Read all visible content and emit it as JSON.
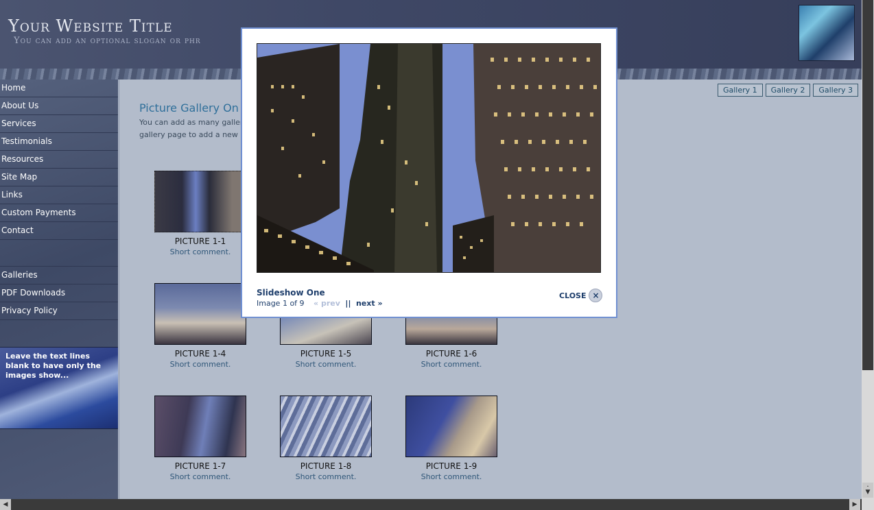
{
  "header": {
    "title": "Your Website Title",
    "slogan": "You can add an optional slogan or phr"
  },
  "sidebar": {
    "items": [
      "Home",
      "About Us",
      "Services",
      "Testimonials",
      "Resources",
      "Site Map",
      "Links",
      "Custom Payments",
      "Contact"
    ],
    "items2": [
      "Galleries",
      "PDF Downloads",
      "Privacy Policy"
    ],
    "promo": "Leave the text lines blank to have only the images show..."
  },
  "content": {
    "tabs": [
      "Gallery 1",
      "Gallery 2",
      "Gallery 3"
    ],
    "title": "Picture Gallery On",
    "intro": "You can add as many galler gallery page to add a new p",
    "thumbs": [
      {
        "label": "PICTURE 1-1",
        "comment": "Short comment."
      },
      {
        "label": "PICTURE 1-4",
        "comment": "Short comment."
      },
      {
        "label": "PICTURE 1-5",
        "comment": "Short comment."
      },
      {
        "label": "PICTURE 1-6",
        "comment": "Short comment."
      },
      {
        "label": "PICTURE 1-7",
        "comment": "Short comment."
      },
      {
        "label": "PICTURE 1-8",
        "comment": "Short comment."
      },
      {
        "label": "PICTURE 1-9",
        "comment": "Short comment."
      }
    ]
  },
  "lightbox": {
    "caption": "Slideshow One",
    "counter": "Image 1 of 9",
    "prev": "« prev",
    "separator": "||",
    "next": "next »",
    "close": "CLOSE",
    "close_icon": "×"
  },
  "scrollbar": {
    "up": "▲",
    "down": "▼",
    "left": "◀",
    "right": "▶"
  }
}
